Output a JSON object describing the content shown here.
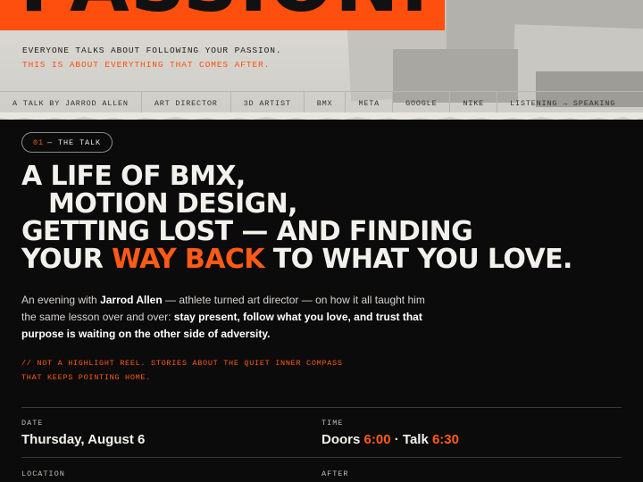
{
  "hero": {
    "word": "PASSION.",
    "tagline_1": "EVERYONE TALKS ABOUT FOLLOWING YOUR PASSION.",
    "tagline_2": "THIS IS ABOUT EVERYTHING THAT COMES AFTER."
  },
  "credits": [
    "A TALK BY JARROD ALLEN",
    "ART DIRECTOR",
    "3D ARTIST",
    "BMX",
    "META",
    "GOOGLE",
    "NIKE",
    "LISTENING → SPEAKING"
  ],
  "section": {
    "number": "01",
    "label": "— THE TALK"
  },
  "headline": {
    "line1": "A LIFE OF BMX,",
    "line2": "MOTION DESIGN,",
    "line3": "GETTING LOST — AND FINDING",
    "line4_start": "YOUR",
    "line4_highlight": "WAY BACK",
    "line4_end": "TO WHAT YOU LOVE."
  },
  "description": {
    "intro": "An evening with",
    "name": "Jarrod Allen",
    "middle": "— athlete turned art director — on how it all taught him the same lesson over and over:",
    "emphasis": "stay present, follow what you love, and trust that purpose is waiting on the other side of adversity."
  },
  "quote": {
    "line1": "// NOT A HIGHLIGHT REEL. STORIES ABOUT THE QUIET INNER COMPASS",
    "line2": "THAT KEEPS POINTING HOME."
  },
  "details": {
    "date_label": "DATE",
    "date_value": "Thursday, August 6",
    "time_label": "TIME",
    "doors_text": "Doors",
    "doors_time": "6:00",
    "separator": "·",
    "talk_text": "Talk",
    "talk_time": "6:30",
    "location_label": "LOCATION",
    "after_label": "AFTER"
  },
  "colors": {
    "accent": "#ff5a16",
    "background": "#0b0b0b",
    "paper": "#d7d5cf"
  }
}
